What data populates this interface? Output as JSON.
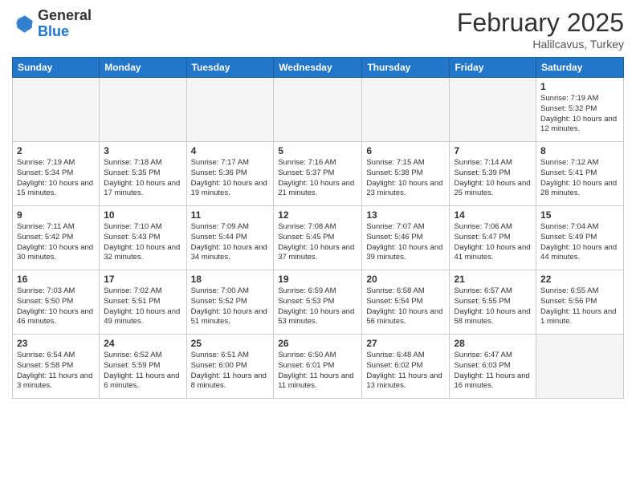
{
  "header": {
    "logo_general": "General",
    "logo_blue": "Blue",
    "month_year": "February 2025",
    "location": "Halilcavus, Turkey"
  },
  "weekdays": [
    "Sunday",
    "Monday",
    "Tuesday",
    "Wednesday",
    "Thursday",
    "Friday",
    "Saturday"
  ],
  "weeks": [
    [
      {
        "day": "",
        "info": ""
      },
      {
        "day": "",
        "info": ""
      },
      {
        "day": "",
        "info": ""
      },
      {
        "day": "",
        "info": ""
      },
      {
        "day": "",
        "info": ""
      },
      {
        "day": "",
        "info": ""
      },
      {
        "day": "1",
        "info": "Sunrise: 7:19 AM\nSunset: 5:32 PM\nDaylight: 10 hours and 12 minutes."
      }
    ],
    [
      {
        "day": "2",
        "info": "Sunrise: 7:19 AM\nSunset: 5:34 PM\nDaylight: 10 hours and 15 minutes."
      },
      {
        "day": "3",
        "info": "Sunrise: 7:18 AM\nSunset: 5:35 PM\nDaylight: 10 hours and 17 minutes."
      },
      {
        "day": "4",
        "info": "Sunrise: 7:17 AM\nSunset: 5:36 PM\nDaylight: 10 hours and 19 minutes."
      },
      {
        "day": "5",
        "info": "Sunrise: 7:16 AM\nSunset: 5:37 PM\nDaylight: 10 hours and 21 minutes."
      },
      {
        "day": "6",
        "info": "Sunrise: 7:15 AM\nSunset: 5:38 PM\nDaylight: 10 hours and 23 minutes."
      },
      {
        "day": "7",
        "info": "Sunrise: 7:14 AM\nSunset: 5:39 PM\nDaylight: 10 hours and 25 minutes."
      },
      {
        "day": "8",
        "info": "Sunrise: 7:12 AM\nSunset: 5:41 PM\nDaylight: 10 hours and 28 minutes."
      }
    ],
    [
      {
        "day": "9",
        "info": "Sunrise: 7:11 AM\nSunset: 5:42 PM\nDaylight: 10 hours and 30 minutes."
      },
      {
        "day": "10",
        "info": "Sunrise: 7:10 AM\nSunset: 5:43 PM\nDaylight: 10 hours and 32 minutes."
      },
      {
        "day": "11",
        "info": "Sunrise: 7:09 AM\nSunset: 5:44 PM\nDaylight: 10 hours and 34 minutes."
      },
      {
        "day": "12",
        "info": "Sunrise: 7:08 AM\nSunset: 5:45 PM\nDaylight: 10 hours and 37 minutes."
      },
      {
        "day": "13",
        "info": "Sunrise: 7:07 AM\nSunset: 5:46 PM\nDaylight: 10 hours and 39 minutes."
      },
      {
        "day": "14",
        "info": "Sunrise: 7:06 AM\nSunset: 5:47 PM\nDaylight: 10 hours and 41 minutes."
      },
      {
        "day": "15",
        "info": "Sunrise: 7:04 AM\nSunset: 5:49 PM\nDaylight: 10 hours and 44 minutes."
      }
    ],
    [
      {
        "day": "16",
        "info": "Sunrise: 7:03 AM\nSunset: 5:50 PM\nDaylight: 10 hours and 46 minutes."
      },
      {
        "day": "17",
        "info": "Sunrise: 7:02 AM\nSunset: 5:51 PM\nDaylight: 10 hours and 49 minutes."
      },
      {
        "day": "18",
        "info": "Sunrise: 7:00 AM\nSunset: 5:52 PM\nDaylight: 10 hours and 51 minutes."
      },
      {
        "day": "19",
        "info": "Sunrise: 6:59 AM\nSunset: 5:53 PM\nDaylight: 10 hours and 53 minutes."
      },
      {
        "day": "20",
        "info": "Sunrise: 6:58 AM\nSunset: 5:54 PM\nDaylight: 10 hours and 56 minutes."
      },
      {
        "day": "21",
        "info": "Sunrise: 6:57 AM\nSunset: 5:55 PM\nDaylight: 10 hours and 58 minutes."
      },
      {
        "day": "22",
        "info": "Sunrise: 6:55 AM\nSunset: 5:56 PM\nDaylight: 11 hours and 1 minute."
      }
    ],
    [
      {
        "day": "23",
        "info": "Sunrise: 6:54 AM\nSunset: 5:58 PM\nDaylight: 11 hours and 3 minutes."
      },
      {
        "day": "24",
        "info": "Sunrise: 6:52 AM\nSunset: 5:59 PM\nDaylight: 11 hours and 6 minutes."
      },
      {
        "day": "25",
        "info": "Sunrise: 6:51 AM\nSunset: 6:00 PM\nDaylight: 11 hours and 8 minutes."
      },
      {
        "day": "26",
        "info": "Sunrise: 6:50 AM\nSunset: 6:01 PM\nDaylight: 11 hours and 11 minutes."
      },
      {
        "day": "27",
        "info": "Sunrise: 6:48 AM\nSunset: 6:02 PM\nDaylight: 11 hours and 13 minutes."
      },
      {
        "day": "28",
        "info": "Sunrise: 6:47 AM\nSunset: 6:03 PM\nDaylight: 11 hours and 16 minutes."
      },
      {
        "day": "",
        "info": ""
      }
    ]
  ]
}
